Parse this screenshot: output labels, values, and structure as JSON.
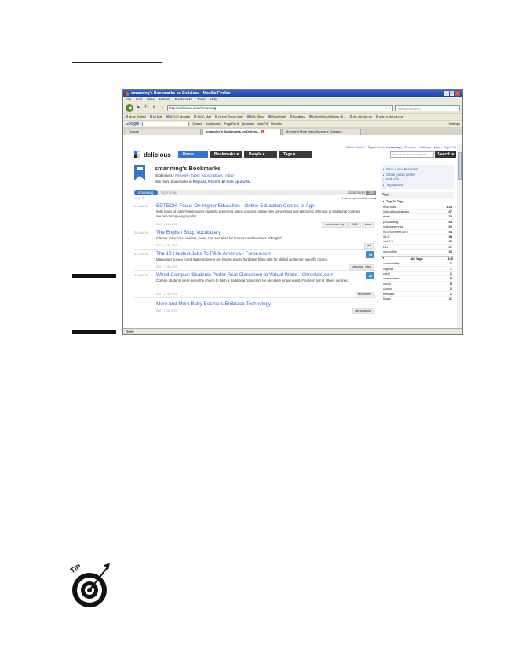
{
  "browser": {
    "window_title": "smanning's Bookmarks on Delicious - Mozilla Firefox",
    "menu": [
      "File",
      "Edit",
      "View",
      "History",
      "Bookmarks",
      "Tools",
      "Help"
    ],
    "url": "http://delicious.com/smanning",
    "search_placeholder": "Wikipedia (en)",
    "bookmarks_toolbar": [
      "Most Visited",
      "UI Mail",
      "MYCR Moodle",
      "WCC Mail",
      "Green Room Mail",
      "EQL Stout",
      "Stout Mail",
      "Bloglines",
      "University of Illinois @...",
      "my del.icio.us",
      "post to del.icio.us"
    ],
    "google_bar": {
      "logo": "Google",
      "items": [
        "Search",
        "Bookmarks",
        "PageRank",
        "AutoLink",
        "AutoFill",
        "Send to",
        "Settings"
      ]
    },
    "tabs": [
      {
        "label": "Google",
        "active": false
      },
      {
        "label": "smanning's Bookmarks on Delicio...",
        "active": true
      },
      {
        "label": "More and More Baby Boomers Embrace ...",
        "active": false
      }
    ],
    "status": "Done"
  },
  "site": {
    "top_links": {
      "whats_new": "What's New?",
      "signed_in": "Signed in as",
      "user": "smanning",
      "inbox": "33 Inbox",
      "settings": "Settings",
      "help": "Help",
      "sign_out": "Sign Out"
    },
    "brand": "delicious",
    "nav": [
      "Home",
      "Bookmarks",
      "People",
      "Tags"
    ],
    "search_placeholder": "Search these bookmarks",
    "search_button": "Search",
    "profile_title": "smanning's Bookmarks",
    "profile_links": [
      "Bookmarks",
      "Network",
      "Tags",
      "Subscriptions",
      "Inbox"
    ],
    "more_text": "See more bookmarks in",
    "more_links": {
      "popular": "Popular",
      "recent": "Recent",
      "or_text": "or",
      "lookup": "look up a URL"
    },
    "actions": [
      "Save a new bookmark",
      "Create public profile",
      "Bulk edit",
      "Tag options"
    ],
    "filter_user": "smanning",
    "tag_placeholder": "Type a tag",
    "bookmarks_label": "Bookmarks",
    "bookmarks_count": "355",
    "sorted_label": "Sorted by",
    "sorted_value": "Most Recent",
    "edit_delete": "EDIT | DELETE"
  },
  "bookmarks": [
    {
      "date": "24 JUN 09",
      "title": "EDTECH: Focus On Higher Education - Online Education Comes of Age",
      "desc": "With many of today's web-savvy students preferring online courses, online-only universities and electronic offerings at traditional colleges are becoming very popular.",
      "tags": [
        "onlinelearning",
        "OLO",
        "book"
      ],
      "saves": ""
    },
    {
      "date": "20 JUN 09",
      "title": "The English Blog: Vocabulary",
      "desc": "Internet resources, reviews, news, tips and trivia for learners and teachers of English",
      "tags": [
        "esl"
      ],
      "saves": ""
    },
    {
      "date": "19 JUN 09",
      "title": "The 10 Hardest Jobs To Fill In America - Forbes.com",
      "desc": "Manpower survey found that employers are having a very hard time filling jobs for skilled workers in specific niches.",
      "tags": [
        "personal_sites"
      ],
      "saves": "14"
    },
    {
      "date": "17 JUN 09",
      "title": "Wired Campus: Students Prefer Real Classroom to Virtual World - Chronicle.com",
      "desc": "College students were given the choice to ditch a traditional classroom for an online virtual world. Fourteen out of fifteen declined.",
      "tags": [
        "secondlife"
      ],
      "saves": "10"
    },
    {
      "date": "",
      "title": "More and More Baby Boomers Embrace Technology",
      "desc": "",
      "tags": [
        "generations"
      ],
      "saves": ""
    }
  ],
  "sidebar": {
    "heading": "Tags",
    "top_label": "Top 10 Tags",
    "top_tags": [
      {
        "name": "tech tools",
        "count": "144"
      },
      {
        "name": "instructionaldesign",
        "count": "87"
      },
      {
        "name": "stout",
        "count": "73"
      },
      {
        "name": "podcasting",
        "count": "64"
      },
      {
        "name": "onlinelearning",
        "count": "62"
      },
      {
        "name": "OLOSummer2007",
        "count": "54"
      },
      {
        "name": "OLO",
        "count": "48"
      },
      {
        "name": "web2.0",
        "count": "48"
      },
      {
        "name": "K12",
        "count": "47"
      },
      {
        "name": "secondlife",
        "count": "33"
      }
    ],
    "all_label": "All Tags",
    "all_count": "165",
    "all_tags": [
      {
        "name": "accessibility",
        "count": "1"
      },
      {
        "name": "adjunct",
        "count": "7"
      },
      {
        "name": "adult",
        "count": "1"
      },
      {
        "name": "assessment",
        "count": "8"
      },
      {
        "name": "audio",
        "count": "5"
      },
      {
        "name": "Aurora",
        "count": "2"
      },
      {
        "name": "blended",
        "count": "1"
      },
      {
        "name": "blogs",
        "count": "11"
      }
    ]
  },
  "tip_label": "TIP"
}
